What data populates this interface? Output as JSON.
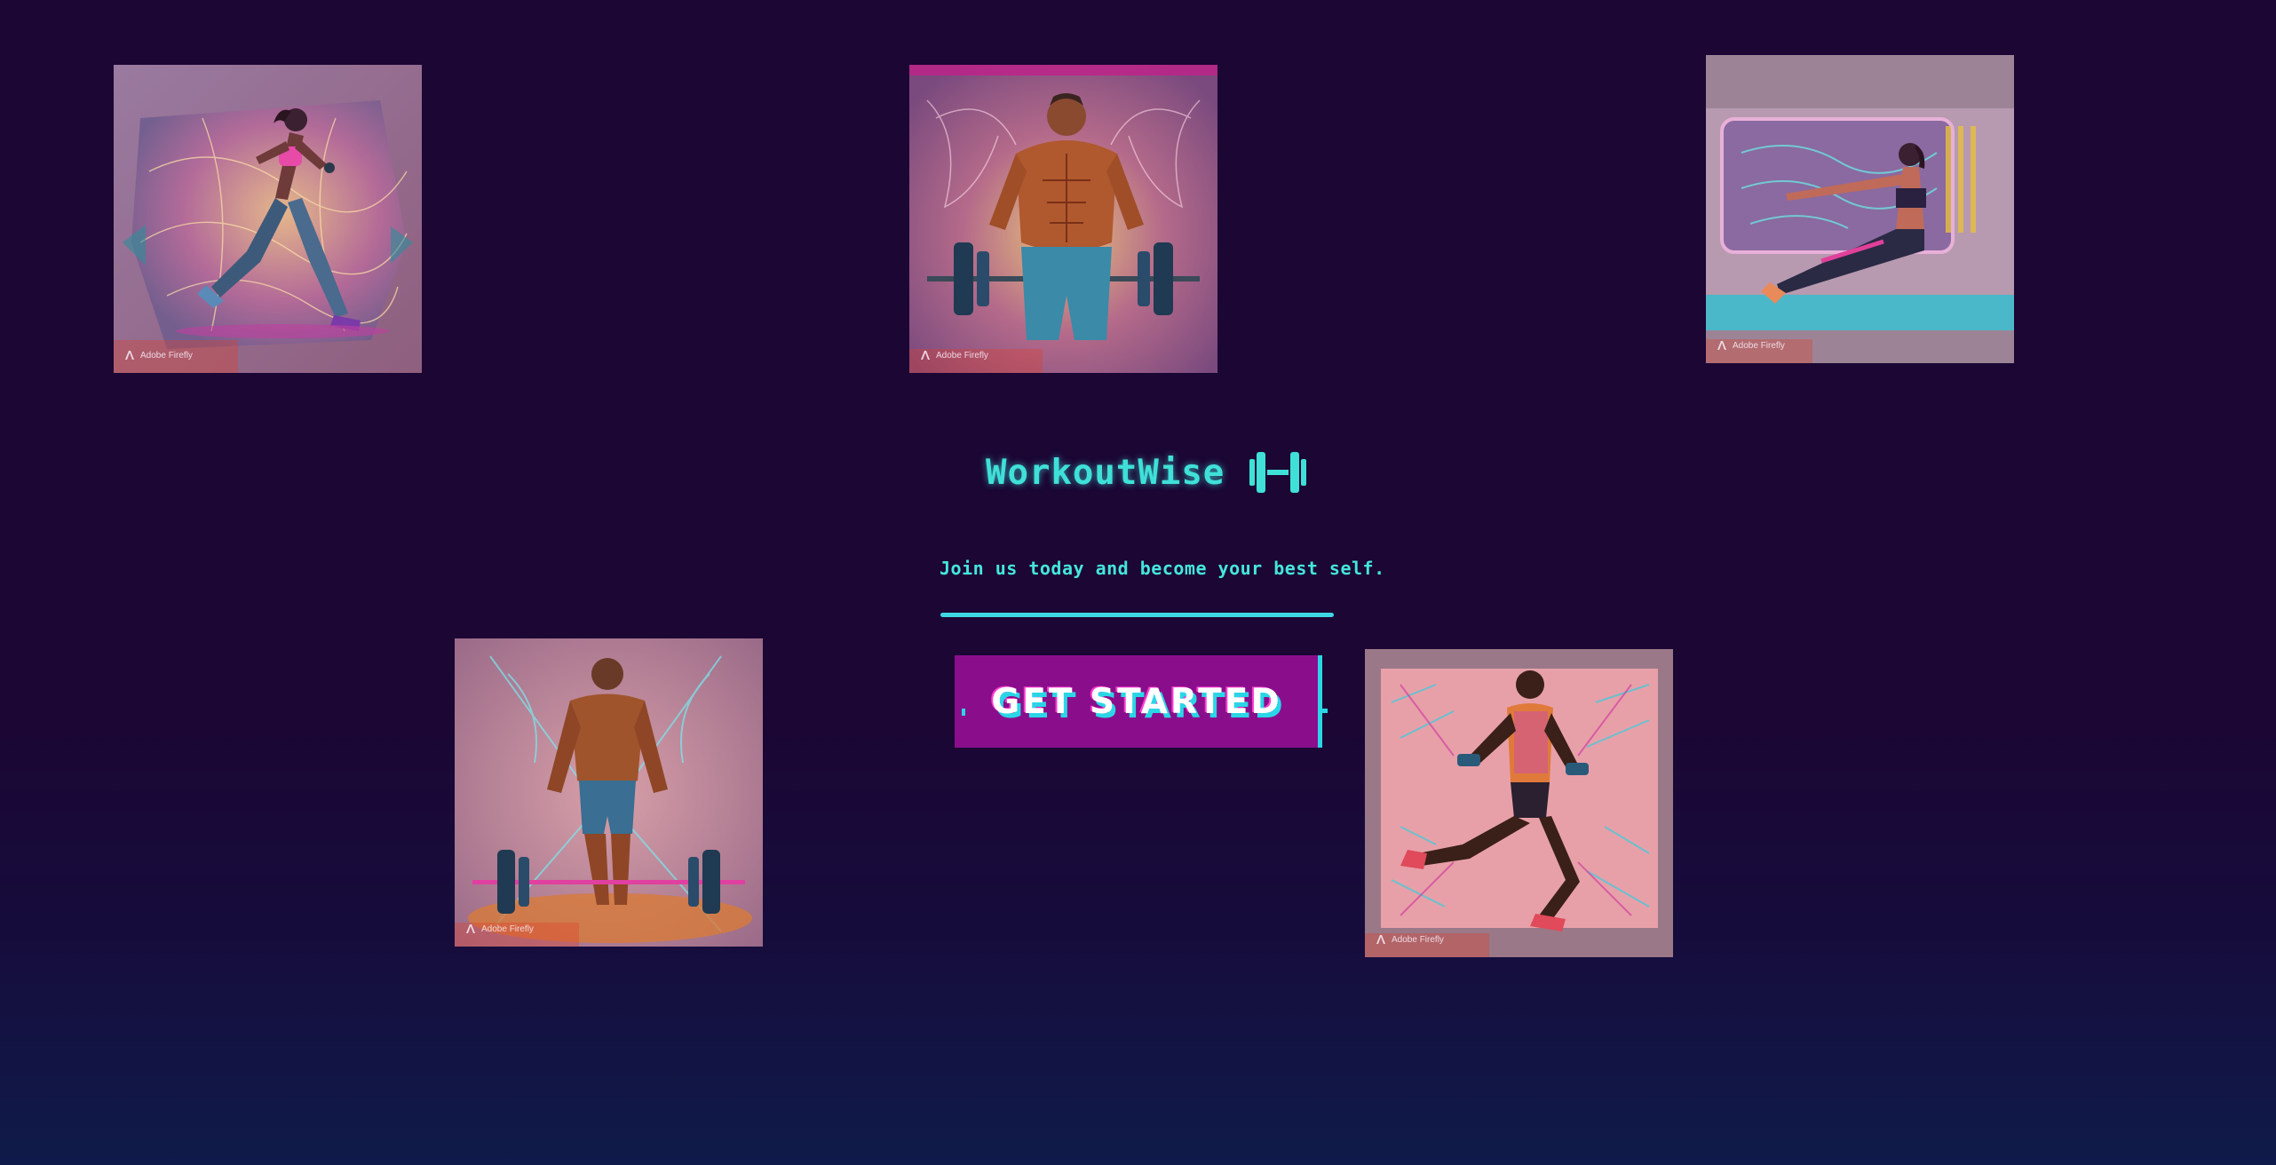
{
  "brand": {
    "name": "WorkoutWise",
    "icon": "dumbbell-icon"
  },
  "hero": {
    "tagline": "Join us today and become your best self.",
    "cta_label": "GET STARTED"
  },
  "gallery": [
    {
      "subject": "runner",
      "watermark": "Adobe Firefly"
    },
    {
      "subject": "barbell-lifter",
      "watermark": "Adobe Firefly"
    },
    {
      "subject": "seated-stretch",
      "watermark": "Adobe Firefly"
    },
    {
      "subject": "deadlift-athlete",
      "watermark": "Adobe Firefly"
    },
    {
      "subject": "dumbbell-runner",
      "watermark": "Adobe Firefly"
    }
  ],
  "colors": {
    "background": "#1b0634",
    "accent": "#3fe0d8",
    "button": "#8a0e8c",
    "button_shadow": "#2ad6e6"
  }
}
